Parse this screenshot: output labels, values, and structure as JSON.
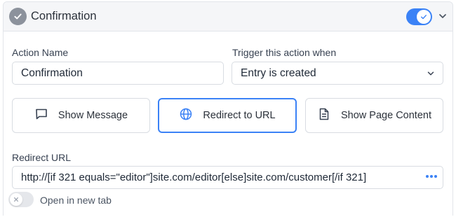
{
  "header": {
    "title": "Confirmation",
    "status_icon": "check-circle-icon",
    "enabled": true,
    "accent_color": "#3b82f6"
  },
  "form": {
    "action_name": {
      "label": "Action Name",
      "value": "Confirmation"
    },
    "trigger": {
      "label": "Trigger this action when",
      "selected": "Entry is created"
    },
    "action_types": [
      {
        "label": "Show Message",
        "icon": "message-square-icon",
        "selected": false
      },
      {
        "label": "Redirect to URL",
        "icon": "globe-icon",
        "selected": true
      },
      {
        "label": "Show Page Content",
        "icon": "file-text-icon",
        "selected": false
      }
    ],
    "redirect_url": {
      "label": "Redirect URL",
      "value": "http://[if 321 equals=\"editor\"]site.com/editor[else]site.com/customer[/if 321]"
    },
    "open_new_tab": {
      "label": "Open in new tab",
      "enabled": false
    }
  }
}
